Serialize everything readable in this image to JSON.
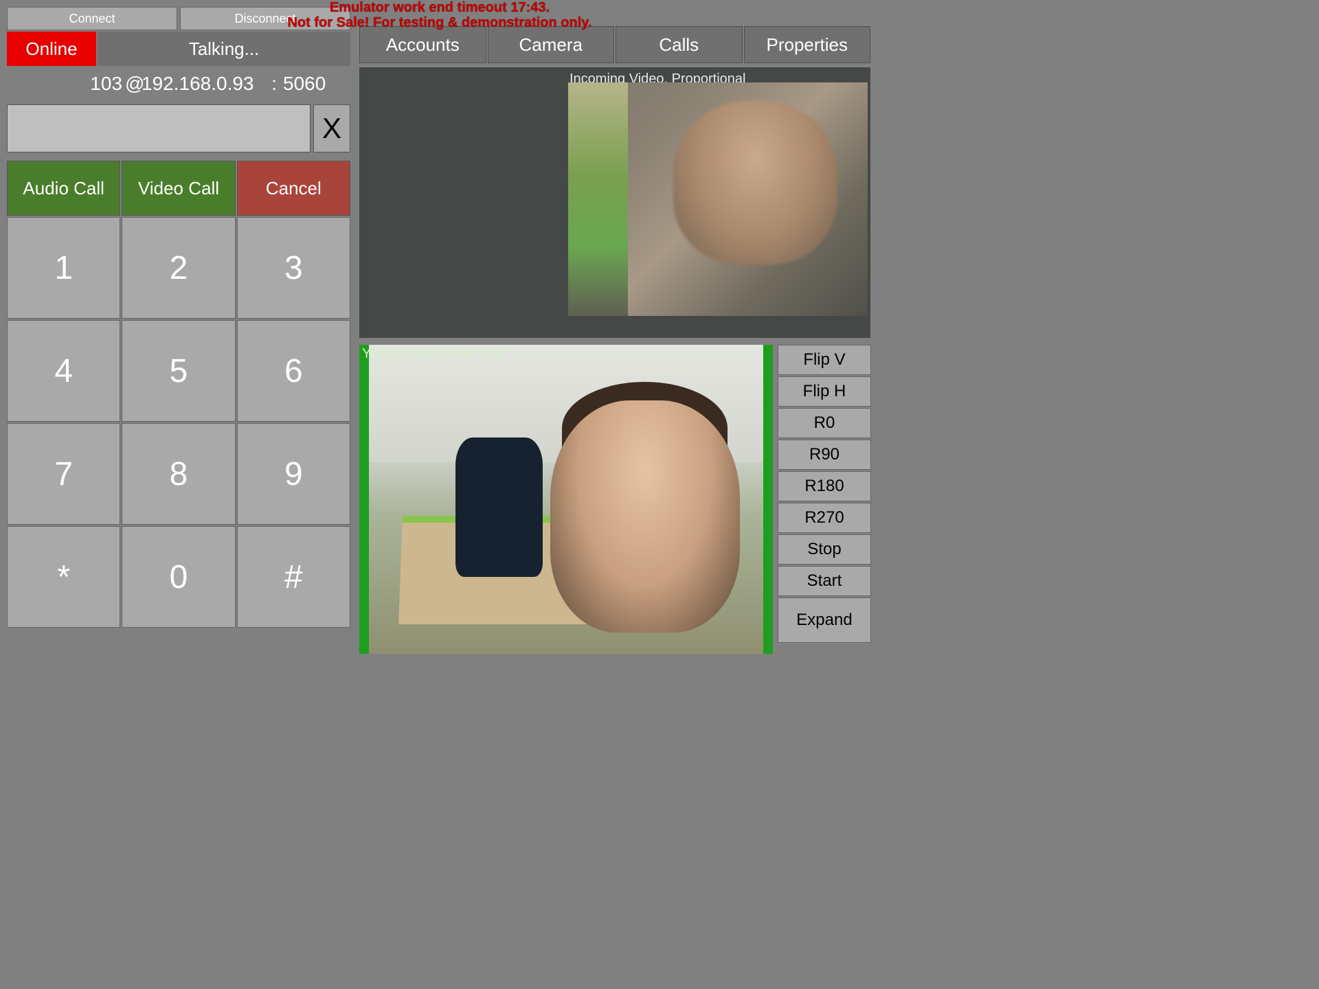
{
  "warning": {
    "line1": "Emulator work end timeout 17:43.",
    "line2": "Not for Sale! For testing & demonstration only."
  },
  "connection_buttons": {
    "connect": "Connect",
    "disconnect": "Disconnect"
  },
  "status": {
    "online": "Online",
    "talking": "Talking..."
  },
  "address": {
    "user": "103",
    "at": "@",
    "host": "192.168.0.93",
    "colon": ":",
    "port": "5060"
  },
  "dialer": {
    "input_value": "",
    "clear_label": "X"
  },
  "call_buttons": {
    "audio": "Audio Call",
    "video": "Video Call",
    "cancel": "Cancel"
  },
  "keypad": [
    "1",
    "2",
    "3",
    "4",
    "5",
    "6",
    "7",
    "8",
    "9",
    "*",
    "0",
    "#"
  ],
  "tabs": [
    "Accounts",
    "Camera",
    "Calls",
    "Properties"
  ],
  "incoming": {
    "caption": "Incoming Video. Proportional"
  },
  "local": {
    "caption": "Your Camera. Full Size"
  },
  "cam_controls": [
    "Flip V",
    "Flip H",
    "R0",
    "R90",
    "R180",
    "R270",
    "Stop",
    "Start",
    "Expand"
  ]
}
